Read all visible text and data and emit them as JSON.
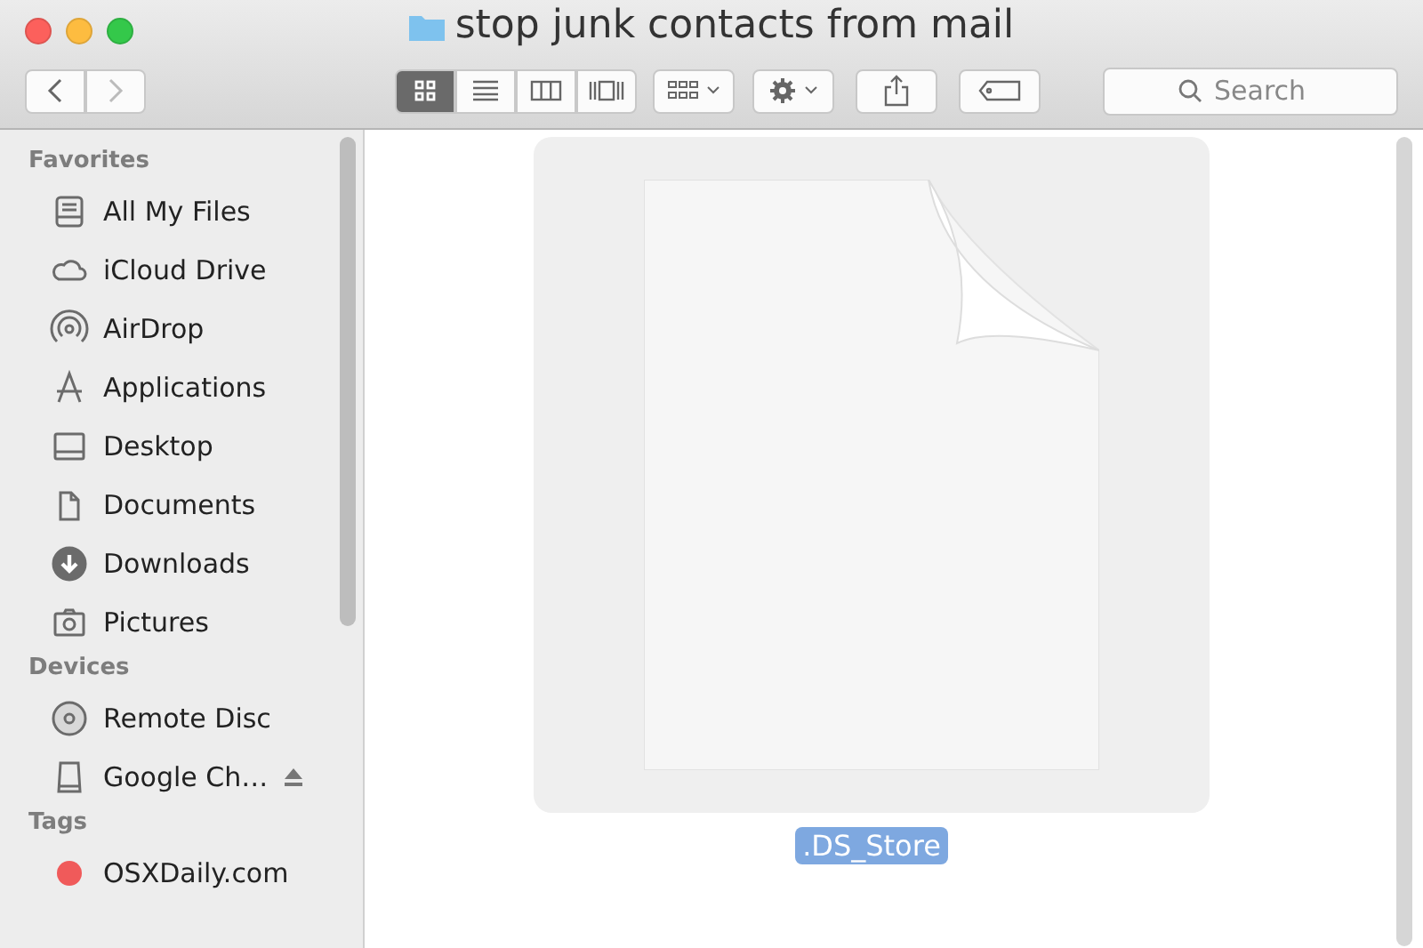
{
  "window": {
    "title": "stop junk contacts from mail"
  },
  "toolbar": {
    "view_modes": [
      {
        "selected": true
      },
      {
        "selected": false
      },
      {
        "selected": false
      },
      {
        "selected": false
      }
    ],
    "search": {
      "placeholder": "Search"
    }
  },
  "sidebar": {
    "sections": [
      {
        "heading": "Favorites",
        "items": [
          {
            "label": "All My Files"
          },
          {
            "label": "iCloud Drive"
          },
          {
            "label": "AirDrop"
          },
          {
            "label": "Applications"
          },
          {
            "label": "Desktop"
          },
          {
            "label": "Documents"
          },
          {
            "label": "Downloads"
          },
          {
            "label": "Pictures"
          }
        ]
      },
      {
        "heading": "Devices",
        "items": [
          {
            "label": "Remote Disc"
          },
          {
            "label": "Google Ch…",
            "ejectable": true
          }
        ]
      },
      {
        "heading": "Tags",
        "items": [
          {
            "label": "OSXDaily.com",
            "color": "#f05a5a"
          }
        ]
      }
    ]
  },
  "files": [
    {
      "name": ".DS_Store",
      "selected": true
    }
  ]
}
